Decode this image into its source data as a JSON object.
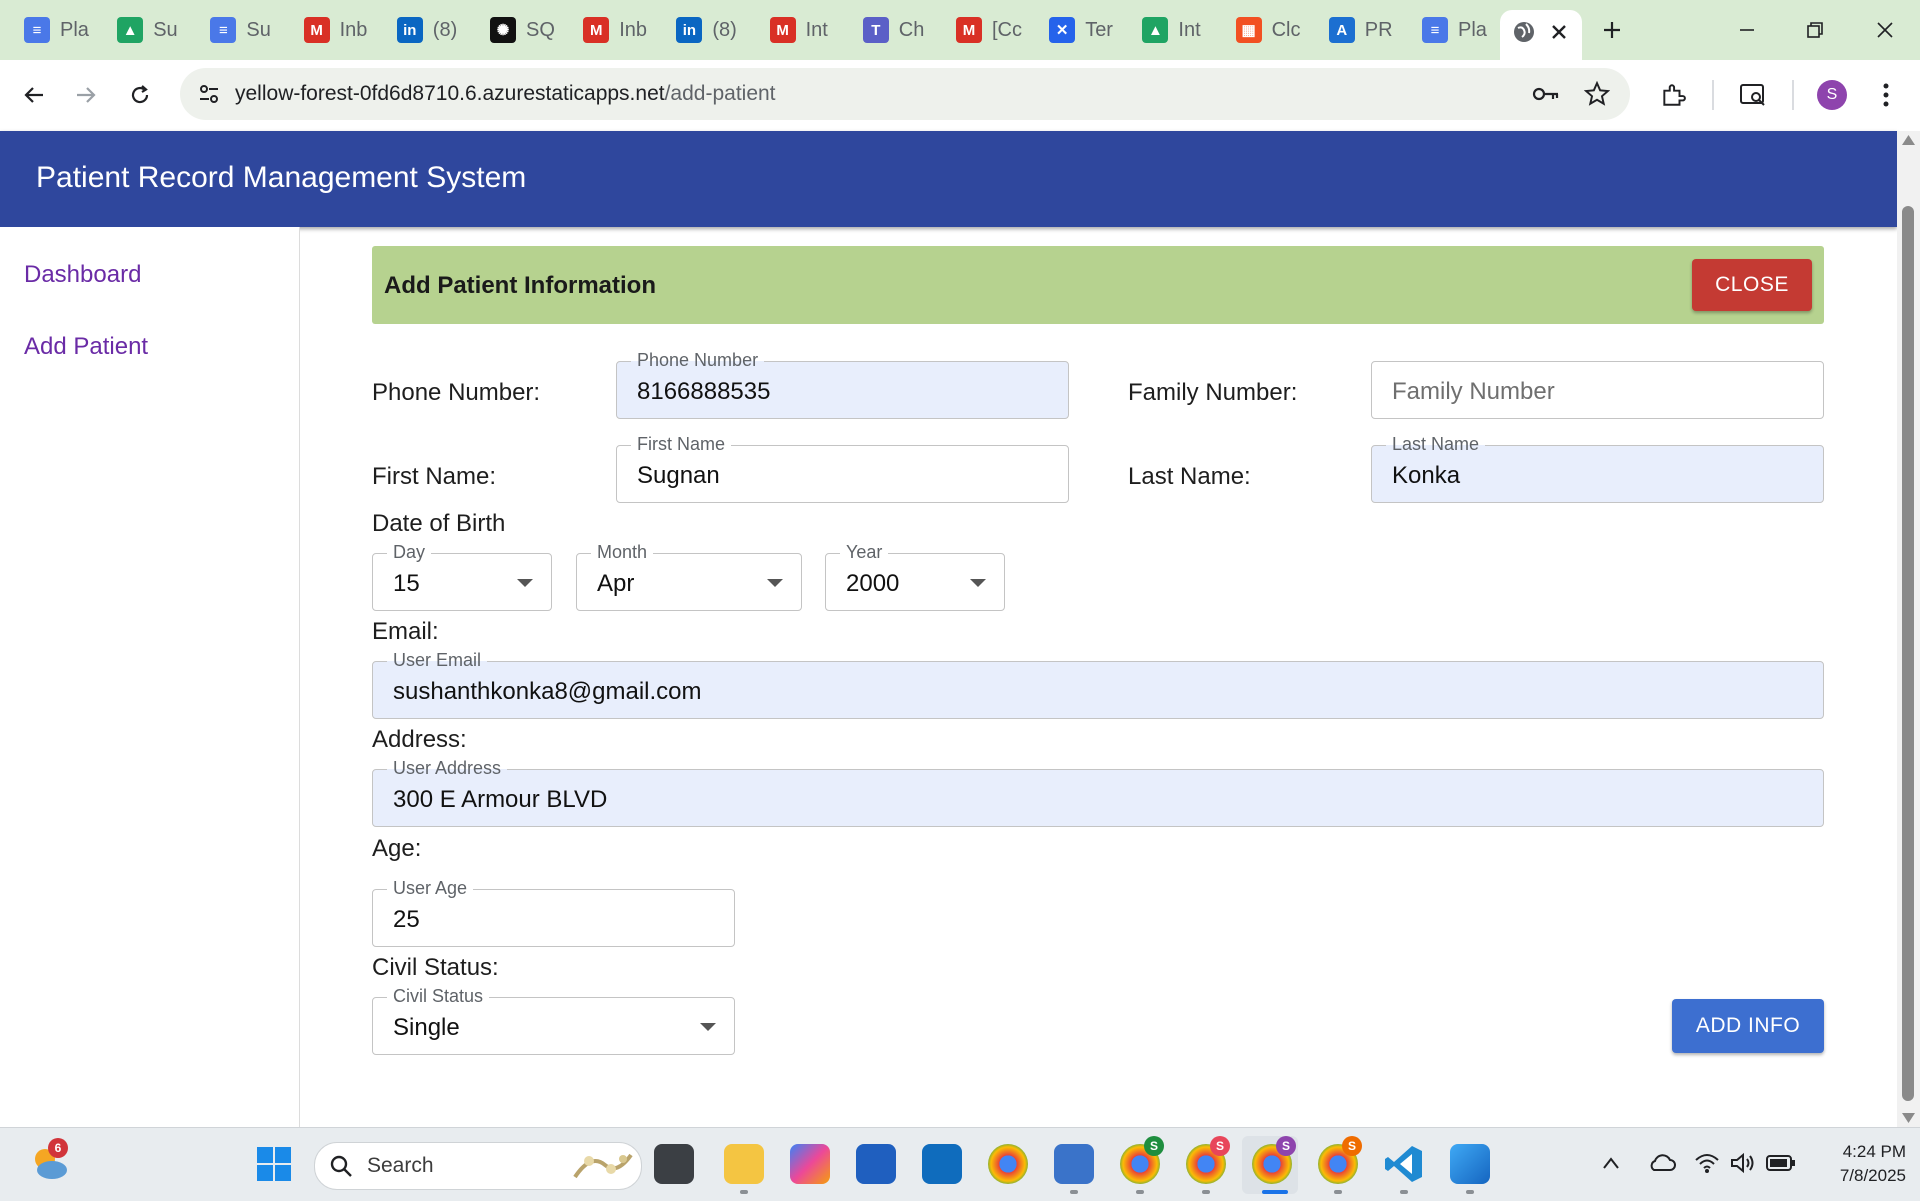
{
  "browser": {
    "tabs": [
      {
        "label": "Pla",
        "icon": "google-docs-icon",
        "color": "#4a78e8"
      },
      {
        "label": "Su",
        "icon": "google-drive-icon",
        "color": "#1fa463"
      },
      {
        "label": "Su",
        "icon": "google-docs-icon",
        "color": "#4a78e8"
      },
      {
        "label": "Inb",
        "icon": "gmail-icon",
        "color": "#d93025"
      },
      {
        "label": "(8)",
        "icon": "linkedin-icon",
        "color": "#0a66c2"
      },
      {
        "label": "SQ",
        "icon": "chatgpt-icon",
        "color": "#111111"
      },
      {
        "label": "Inb",
        "icon": "gmail-icon",
        "color": "#d93025"
      },
      {
        "label": "(8)",
        "icon": "linkedin-icon",
        "color": "#0a66c2"
      },
      {
        "label": "Int",
        "icon": "gmail-icon",
        "color": "#d93025"
      },
      {
        "label": "Ch",
        "icon": "teams-icon",
        "color": "#5b5fc7"
      },
      {
        "label": "[Cc",
        "icon": "gmail-icon",
        "color": "#d93025"
      },
      {
        "label": "Ter",
        "icon": "confluence-icon",
        "color": "#2563eb"
      },
      {
        "label": "Int",
        "icon": "google-drive-icon",
        "color": "#1fa463"
      },
      {
        "label": "Clc",
        "icon": "microsoft-icon",
        "color": "#f25022"
      },
      {
        "label": "PR",
        "icon": "azure-icon",
        "color": "#1c6fd1"
      },
      {
        "label": "Pla",
        "icon": "google-docs-icon",
        "color": "#4a78e8"
      }
    ],
    "active_tab_icon": "globe-icon",
    "url_host": "yellow-forest-0fd6d8710.6.azurestaticapps.net",
    "url_path": "/add-patient",
    "profile_initial": "S",
    "profile_color": "#8e44ad"
  },
  "app": {
    "title": "Patient Record Management System",
    "header_color": "#2f479d",
    "nav": {
      "dashboard": "Dashboard",
      "add_patient": "Add Patient"
    },
    "form": {
      "heading": "Add Patient Information",
      "close_label": "CLOSE",
      "phone": {
        "row_label": "Phone Number:",
        "field_label": "Phone Number",
        "value": "8166888535"
      },
      "family": {
        "row_label": "Family Number:",
        "placeholder": "Family Number",
        "value": ""
      },
      "first_name": {
        "row_label": "First Name:",
        "field_label": "First Name",
        "value": "Sugnan"
      },
      "last_name": {
        "row_label": "Last Name:",
        "field_label": "Last Name",
        "value": "Konka"
      },
      "dob": {
        "label": "Date of Birth",
        "day": {
          "field_label": "Day",
          "value": "15"
        },
        "month": {
          "field_label": "Month",
          "value": "Apr"
        },
        "year": {
          "field_label": "Year",
          "value": "2000"
        }
      },
      "email": {
        "row_label": "Email:",
        "field_label": "User Email",
        "value": "sushanthkonka8@gmail.com"
      },
      "address": {
        "row_label": "Address:",
        "field_label": "User Address",
        "value": "300 E Armour BLVD"
      },
      "age": {
        "row_label": "Age:",
        "field_label": "User Age",
        "value": "25"
      },
      "civil_status": {
        "row_label": "Civil Status:",
        "field_label": "Civil Status",
        "value": "Single"
      },
      "submit_label": "ADD INFO"
    }
  },
  "taskbar": {
    "search_placeholder": "Search",
    "weather_badge": "6",
    "clock_time": "4:24 PM",
    "clock_date": "7/8/2025"
  }
}
